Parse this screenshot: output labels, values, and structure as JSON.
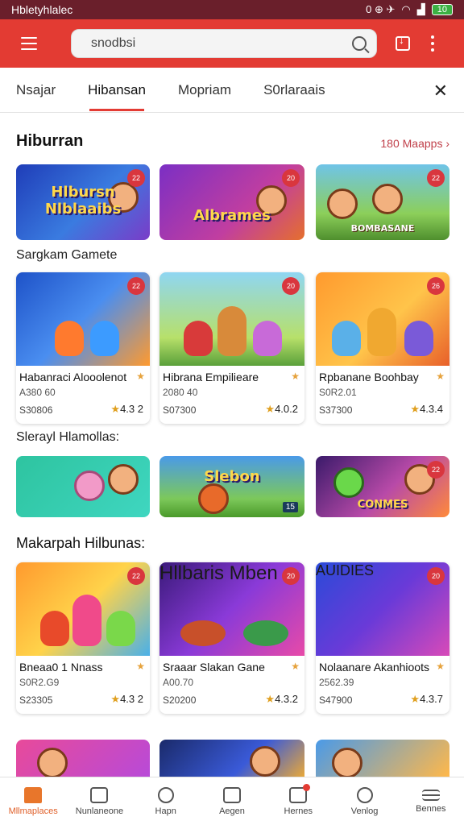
{
  "status": {
    "carrier": "Hbletyhlalec",
    "icons": "0 ⊕ ✈",
    "battery": "10"
  },
  "search": {
    "placeholder": "snodbsi"
  },
  "tabs": [
    "Nsajar",
    "Hibansan",
    "Mopriam",
    "S0rlaraais"
  ],
  "sections": {
    "s1": {
      "title": "Hiburran",
      "see_more": "180 Maapps ›"
    },
    "s2": {
      "title": "Sargkam Gamete"
    },
    "s3": {
      "title": "Slerayl Hlamollas:"
    },
    "s4": {
      "title": "Makarpah Hilbunas:"
    }
  },
  "banners_top": [
    {
      "label": "Hlbursn Nlblaaibs",
      "badge": "22"
    },
    {
      "label": "Albrames",
      "badge": "20"
    },
    {
      "label": "BOMBASANE",
      "badge": "22"
    }
  ],
  "cards_row1": [
    {
      "name": "Habanraci Alooolenot",
      "sub": "A380 60",
      "price": "S30806",
      "rating": "4.3 2",
      "badge": "22"
    },
    {
      "name": "Hibrana Empilieare",
      "sub": "2080 40",
      "price": "S07300",
      "rating": "4.0.2",
      "badge": "20"
    },
    {
      "name": "Rpbanane Boohbay",
      "sub": "S0R2.01",
      "price": "S37300",
      "rating": "4.3.4",
      "badge": "26"
    }
  ],
  "banners_mid": [
    {
      "label": "",
      "badge": ""
    },
    {
      "label": "Slebon",
      "badge": "15"
    },
    {
      "label": "CONMES",
      "badge": "22"
    }
  ],
  "cards_row2": [
    {
      "name": "Bneaa0 1 Nnass",
      "sub": "S0R2.G9",
      "price": "S23305",
      "rating": "4.3 2",
      "badge": "22"
    },
    {
      "name": "Sraaar Slakan Gane",
      "sub": "A00.70",
      "price": "S20200",
      "rating": "4.3.2",
      "badge": "20"
    },
    {
      "name": "Nolaanare Akanhioots",
      "sub": "2562.39",
      "price": "S47900",
      "rating": "4.3.7",
      "badge": "20"
    }
  ],
  "bottom_nav": [
    {
      "label": "Mllmaplaces",
      "icon": "home-icon"
    },
    {
      "label": "Nunlaneone",
      "icon": "box-icon"
    },
    {
      "label": "Hapn",
      "icon": "search-icon"
    },
    {
      "label": "Aegen",
      "icon": "map-icon"
    },
    {
      "label": "Hernes",
      "icon": "mail-icon"
    },
    {
      "label": "Venlog",
      "icon": "profile-icon"
    },
    {
      "label": "Bennes",
      "icon": "menu-icon"
    }
  ],
  "colors": {
    "accent": "#e33b33",
    "status_bar": "#6a1f2b",
    "active_nav": "#e8762b"
  }
}
